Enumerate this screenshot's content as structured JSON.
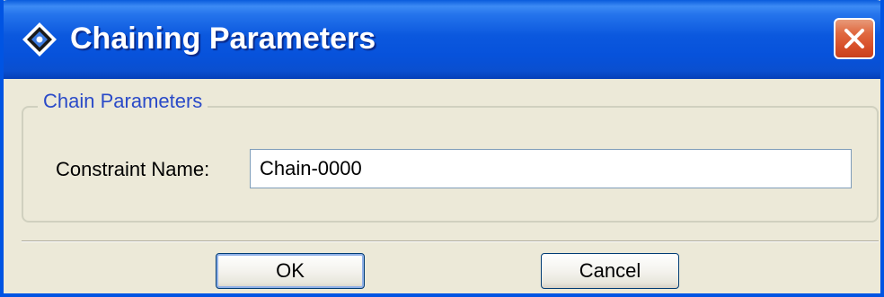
{
  "window": {
    "title": "Chaining Parameters",
    "icons": {
      "app": "diamond-app-icon",
      "close": "close-icon"
    }
  },
  "chain_group": {
    "legend": "Chain Parameters",
    "constraint_name_label": "Constraint Name:",
    "constraint_name_value": "Chain-0000"
  },
  "buttons": {
    "ok_label": "OK",
    "cancel_label": "Cancel"
  },
  "colors": {
    "title_bar": "#0054e3",
    "close_button": "#e06a41",
    "dialog_background": "#ece9d8",
    "group_legend_text": "#2a4ac8"
  }
}
